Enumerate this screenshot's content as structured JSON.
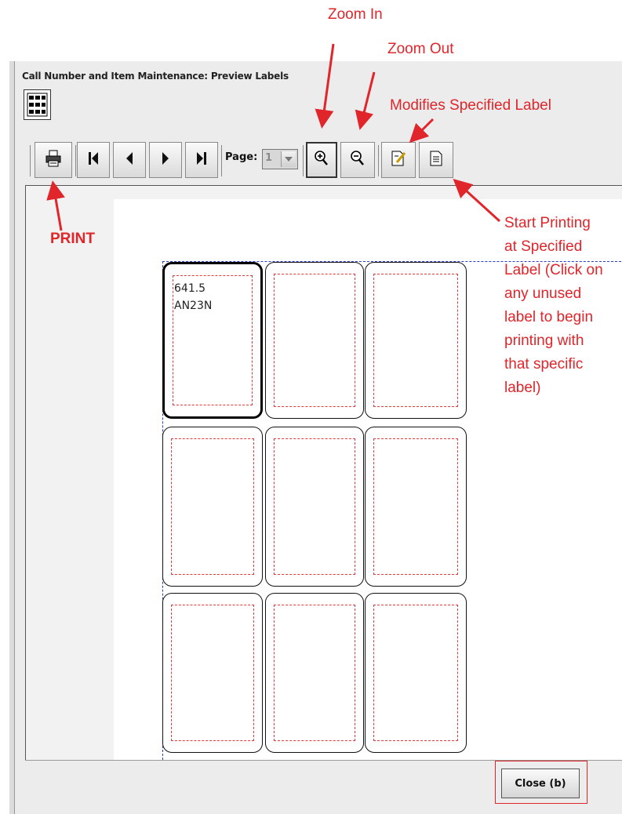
{
  "window": {
    "title": "Call Number and Item Maintenance: Preview Labels"
  },
  "toolbar": {
    "page_label": "Page:",
    "page_value": "1",
    "buttons": [
      {
        "name": "print",
        "icon": "printer-icon"
      },
      {
        "name": "first-page",
        "icon": "first-page-icon"
      },
      {
        "name": "previous-page",
        "icon": "previous-icon"
      },
      {
        "name": "next-page",
        "icon": "next-icon"
      },
      {
        "name": "last-page",
        "icon": "last-page-icon"
      },
      {
        "name": "zoom-in",
        "icon": "zoom-in-icon"
      },
      {
        "name": "zoom-out",
        "icon": "zoom-out-icon"
      },
      {
        "name": "modify-label",
        "icon": "edit-document-icon"
      },
      {
        "name": "start-printing",
        "icon": "document-icon"
      }
    ]
  },
  "labels": {
    "first_label_lines": [
      "641.5",
      "AN23N"
    ],
    "rows": 3,
    "columns": 3
  },
  "footer": {
    "close_label": "Close (b)"
  },
  "annotations": {
    "zoom_in": "Zoom In",
    "zoom_out": "Zoom Out",
    "modifies": "Modifies Specified Label",
    "print": "PRINT",
    "start_printing": [
      "Start Printing",
      "at Specified",
      "Label (Click on",
      "any unused",
      "label to begin",
      "printing with",
      "that specific",
      "label)"
    ],
    "color": "#e0252b"
  }
}
